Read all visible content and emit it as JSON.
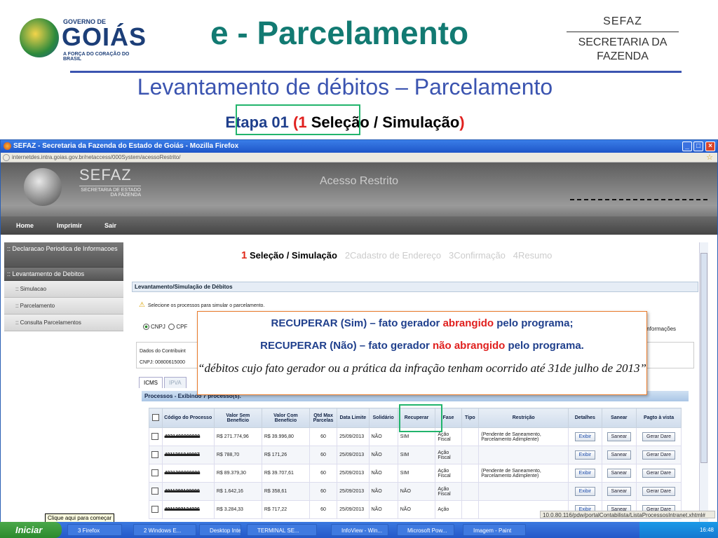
{
  "slide": {
    "title": "e - Parcelamento",
    "subtitle": "Levantamento de débitos – Parcelamento",
    "etapa_prefix": "Etapa 01 ",
    "etapa_open": "(",
    "etapa_num": "1",
    "etapa_label": " Seleção / Simulação",
    "etapa_close": ")",
    "logo_goias": {
      "top": "GOVERNO DE",
      "main": "GOIÁS",
      "tag": "A FORÇA DO CORAÇÃO DO BRASIL"
    },
    "logo_sefaz": {
      "top": "SEFAZ",
      "line1": "SECRETARIA DA",
      "line2": "FAZENDA"
    }
  },
  "browser": {
    "title": "SEFAZ - Secretaria da Fazenda do Estado de Goiás - Mozilla Firefox",
    "url": "internetdes.intra.goias.gov.br/netaccess/000System/acessoRestrito/",
    "status_url": "10.0.80.116/pdw/portalContabilista/ListaProcessosIntranet.xhtml#"
  },
  "site": {
    "logo_name": "SEFAZ",
    "logo_sub1": "SECRETARIA DE ESTADO",
    "logo_sub2": "DA FAZENDA",
    "header_title": "Acesso Restrito",
    "menu": [
      "Home",
      "Imprimir",
      "Sair"
    ]
  },
  "nav": {
    "sec1": ":: Declaracao Periodica de Informacoes",
    "sec2": ":: Levantamento de Debitos",
    "items": [
      ":: Simulacao",
      ":: Parcelamento",
      ":: Consulta Parcelamentos"
    ]
  },
  "steps": {
    "s1_num": "1",
    "s1": " Seleção / Simulação",
    "s2_num": "2",
    "s2": "Cadastro de Endereço",
    "s3_num": "3",
    "s3": "Confirmação",
    "s4_num": "4",
    "s4": "Resumo"
  },
  "content": {
    "section_title": "Levantamento/Simulação de Débitos",
    "warning": "Selecione os processos para simular o parcelamento.",
    "radio_cnpj": "CNPJ",
    "radio_cpf": "CPF",
    "info_label": "Informações",
    "contrib_label": "Dados do Contribuint",
    "cnpj_value": "CNPJ: 00800615000",
    "tabs": [
      "ICMS",
      "IPVA"
    ],
    "processes_title": "Processos - Exibindo 7 processo(s)."
  },
  "table": {
    "headers": [
      "Código do Processo",
      "Valor Sem Benefício",
      "Valor Com Benefício",
      "Qtd Max Parcelas",
      "Data Limite",
      "Solidário",
      "Recuperar",
      "Fase",
      "Tipo",
      "Restrição",
      "Detalhes",
      "Sanear",
      "Pagto à vista"
    ],
    "rows": [
      {
        "codigo": "4031400000000",
        "sem": "R$ 271.774,96",
        "com": "R$ 39.996,80",
        "qtd": "60",
        "data": "25/09/2013",
        "sol": "NÃO",
        "rec": "SIM",
        "fase": "Ação Fiscal",
        "tipo": "",
        "restr": "(Pendente de Saneamento, Parcelamento Adimplente)"
      },
      {
        "codigo": "4011301040007",
        "sem": "R$ 788,70",
        "com": "R$ 171,26",
        "qtd": "60",
        "data": "25/09/2013",
        "sol": "NÃO",
        "rec": "SIM",
        "fase": "Ação Fiscal",
        "tipo": "",
        "restr": ""
      },
      {
        "codigo": "4031300000000",
        "sem": "R$ 89.379,30",
        "com": "R$ 39.707,61",
        "qtd": "60",
        "data": "25/09/2013",
        "sol": "NÃO",
        "rec": "SIM",
        "fase": "Ação Fiscal",
        "tipo": "",
        "restr": "(Pendente de Saneamento, Parcelamento Adimplente)"
      },
      {
        "codigo": "4011300100000",
        "sem": "R$ 1.642,16",
        "com": "R$ 358,61",
        "qtd": "60",
        "data": "25/09/2013",
        "sol": "NÃO",
        "rec": "NÃO",
        "fase": "Ação Fiscal",
        "tipo": "",
        "restr": ""
      },
      {
        "codigo": "4011302134236",
        "sem": "R$ 3.284,33",
        "com": "R$ 717,22",
        "qtd": "60",
        "data": "25/09/2013",
        "sol": "NÃO",
        "rec": "NÃO",
        "fase": "Ação",
        "tipo": "",
        "restr": ""
      }
    ],
    "btn_exibir": "Exibir",
    "btn_sanear": "Sanear",
    "btn_gerar": "Gerar Dare"
  },
  "callout": {
    "l1_a": "RECUPERAR (Sim) – fato gerador ",
    "l1_b": "abrangido",
    "l1_c": " pelo programa;",
    "l2_a": "RECUPERAR (Não) – fato gerador ",
    "l2_b": "não abrangido",
    "l2_c": " pelo programa.",
    "l3": "“débitos cujo fato gerador ou a prática da infração tenham ocorrido até 31de julho de 2013”"
  },
  "taskbar": {
    "start": "Iniciar",
    "tooltip": "Clique aqui para começar",
    "tasks": [
      "3 Firefox",
      "2 Windows E...",
      "Desktop Intelli...",
      "TERMINAL SE...",
      "InfoView - Win...",
      "Microsoft Pow...",
      "Imagem - Paint"
    ],
    "clock": "16:48"
  },
  "colors": {
    "accent": "#127a72",
    "blue": "#3b54b0",
    "highlight": "#22b46c",
    "red": "#e0201e"
  }
}
